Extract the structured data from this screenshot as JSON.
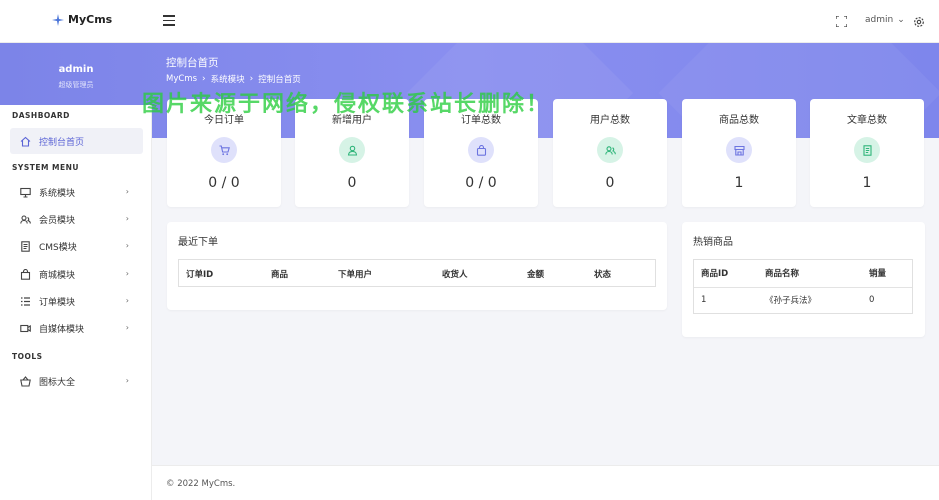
{
  "app": {
    "brand": "MyCms"
  },
  "header": {
    "user": "admin"
  },
  "banner": {
    "title": "控制台首页",
    "breadcrumbs": [
      "MyCms",
      "系统模块",
      "控制台首页"
    ]
  },
  "sidebar": {
    "user_name": "admin",
    "user_role": "超级管理员",
    "sections": {
      "dashboard": "DASHBOARD",
      "system": "SYSTEM MENU",
      "tools": "TOOLS"
    },
    "items": [
      {
        "label": "控制台首页",
        "icon": "home-icon",
        "active": true
      },
      {
        "label": "系统模块",
        "icon": "monitor-icon"
      },
      {
        "label": "会员模块",
        "icon": "users-icon"
      },
      {
        "label": "CMS模块",
        "icon": "document-icon"
      },
      {
        "label": "商城模块",
        "icon": "bag-icon"
      },
      {
        "label": "订单模块",
        "icon": "list-icon"
      },
      {
        "label": "自媒体模块",
        "icon": "video-icon"
      },
      {
        "label": "图标大全",
        "icon": "basket-icon"
      }
    ]
  },
  "stats": [
    {
      "label": "今日订单",
      "value": "0 / 0",
      "icon": "cart-icon",
      "color": "#dfe1fb"
    },
    {
      "label": "新增用户",
      "value": "0",
      "icon": "user-icon",
      "color": "#d6f3e6"
    },
    {
      "label": "订单总数",
      "value": "0 / 0",
      "icon": "bag-icon",
      "color": "#dfe1fb"
    },
    {
      "label": "用户总数",
      "value": "0",
      "icon": "users-icon",
      "color": "#d6f3e6"
    },
    {
      "label": "商品总数",
      "value": "1",
      "icon": "store-icon",
      "color": "#dfe1fb"
    },
    {
      "label": "文章总数",
      "value": "1",
      "icon": "article-icon",
      "color": "#d6f3e6"
    }
  ],
  "watermark": "图片来源于网络，侵权联系站长删除！",
  "recent_orders": {
    "title": "最近下单",
    "columns": [
      "订单ID",
      "商品",
      "下单用户",
      "收货人",
      "金额",
      "状态"
    ]
  },
  "hot_products": {
    "title": "热销商品",
    "columns": [
      "商品ID",
      "商品名称",
      "销量"
    ],
    "rows": [
      [
        "1",
        "《孙子兵法》",
        "0"
      ]
    ]
  },
  "footer": {
    "copyright": "© 2022 MyCms."
  },
  "colors": {
    "accent": "#7c84e8",
    "active_text": "#5b64d6",
    "watermark": "#28cd3c"
  }
}
